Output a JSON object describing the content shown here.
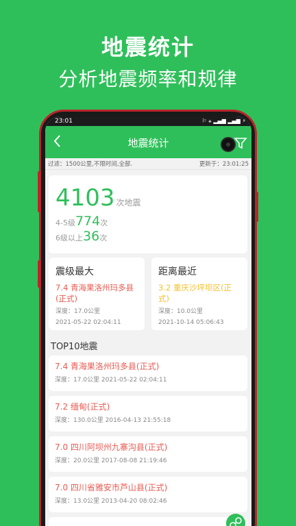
{
  "hero": {
    "title": "地震统计",
    "subtitle": "分析地震频率和规律"
  },
  "status": {
    "time": "23:01",
    "icons": "⚐ ⚹ ▂▄▆ ▂▄▆ ⚡"
  },
  "appbar": {
    "title": "地震统计"
  },
  "filter": {
    "label": "过滤：1500公里,不限时间,全部.",
    "updated": "更新于：23:01:25"
  },
  "summary": {
    "total": "4103",
    "total_unit": "次地震",
    "mid_prefix": "4-5级",
    "mid_count": "774",
    "mid_unit": "次",
    "high_prefix": "6级以上",
    "high_count": "36",
    "high_unit": "次"
  },
  "max_mag": {
    "heading": "震级最大",
    "place": "7.4   青海果洛州玛多县(正式)",
    "depth": "深度：17.0公里",
    "time": "2021-05-22 02:04:11"
  },
  "nearest": {
    "heading": "距离最近",
    "place": "3.2   重庆沙坪坝区(正式)",
    "depth": "深度：10.0公里",
    "time": "2021-10-14 05:06:43"
  },
  "top10": {
    "heading": "TOP10地震",
    "items": [
      {
        "title": "7.4   青海果洛州玛多县(正式)",
        "meta": "深度：17.0公里    2021-05-22 02:04:11"
      },
      {
        "title": "7.2   缅甸(正式)",
        "meta": "深度：130.0公里    2016-04-13 21:55:18"
      },
      {
        "title": "7.0   四川阿坝州九寨沟县(正式)",
        "meta": "深度：20.0公里    2017-08-08 21:19:46"
      },
      {
        "title": "7.0   四川省雅安市芦山县(正式)",
        "meta": "深度：13.0公里    2013-04-20 08:02:46"
      }
    ]
  },
  "colors": {
    "brand": "#2fbf5a",
    "alert_red": "#e85a50",
    "alert_yellow": "#f2c230"
  }
}
